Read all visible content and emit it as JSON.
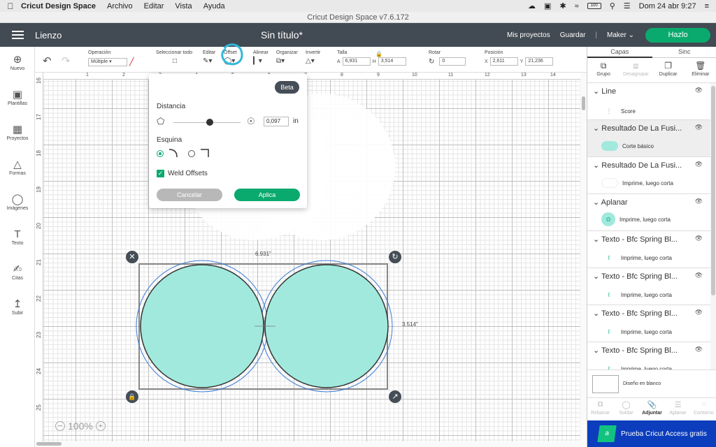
{
  "macos": {
    "app_name": "Cricut Design Space",
    "menus": [
      "Archivo",
      "Editar",
      "Vista",
      "Ayuda"
    ],
    "datetime": "Dom 24 abr  9:27",
    "battery": "100"
  },
  "window_title": "Cricut Design Space  v7.6.172",
  "header": {
    "section": "Lienzo",
    "doc_title": "Sin título*",
    "my_projects": "Mis proyectos",
    "save": "Guardar",
    "separator": "|",
    "machine": "Maker",
    "make_button": "Hazlo"
  },
  "leftnav": [
    "Nuevo",
    "Plantillas",
    "Proyectos",
    "Formas",
    "Imágenes",
    "Texto",
    "Citas",
    "Subir"
  ],
  "toolbar": {
    "operation_label": "Operación",
    "operation_value": "Múltiple",
    "select_all": "Seleccionar todo",
    "edit": "Editar",
    "offset": "Offset",
    "align": "Alinear",
    "organize": "Organizar",
    "flip": "Invertir",
    "size": "Talla",
    "width_label": "A",
    "width_value": "6,931",
    "height_label": "H",
    "height_value": "3,514",
    "rotate": "Rotar",
    "rotate_value": "0",
    "position": "Posición",
    "x_label": "X",
    "x_value": "2,611",
    "y_label": "Y",
    "y_value": "21,236"
  },
  "rulers": {
    "top": [
      "1",
      "2",
      "3",
      "4",
      "5",
      "6",
      "7",
      "8",
      "9",
      "10",
      "11",
      "12",
      "13",
      "14"
    ],
    "left": [
      "16",
      "17",
      "18",
      "19",
      "20",
      "21",
      "22",
      "23",
      "24",
      "25"
    ]
  },
  "canvas": {
    "width_dim": "6.931\"",
    "height_dim": "3.514\"",
    "zoom": "100%",
    "fill_color": "#a1e9dd",
    "offset_color": "#3b7bd6"
  },
  "offset_popup": {
    "badge": "Beta",
    "distance_label": "Distancia",
    "distance_value": "0,097",
    "unit": "in",
    "slider_value": 0.55,
    "corner_label": "Esquina",
    "weld_label": "Weld Offsets",
    "cancel": "Cancelar",
    "apply": "Aplica"
  },
  "panel": {
    "tabs": [
      "Capas",
      "Sinc"
    ],
    "actions": [
      "Grupo",
      "Desagrupar",
      "Duplicar",
      "Eliminar"
    ],
    "layers": [
      {
        "name": "Line",
        "child": "Score"
      },
      {
        "name": "Resultado De La Fusi...",
        "child": "Corte básico"
      },
      {
        "name": "Resultado De La Fusi...",
        "child": "Imprime, luego corta"
      },
      {
        "name": "Aplanar",
        "child": "Imprime, luego corta"
      },
      {
        "name": "Texto - Bfc Spring Bl...",
        "child": "Imprime, luego corta"
      },
      {
        "name": "Texto - Bfc Spring Bl...",
        "child": "Imprime, luego corta"
      },
      {
        "name": "Texto - Bfc Spring Bl...",
        "child": "Imprime, luego corta"
      },
      {
        "name": "Texto - Bfc Spring Bl...",
        "child": "Imprime, luego corta"
      }
    ],
    "blank_canvas": "Diseño en blanco",
    "bottom_actions": [
      "Rebanar",
      "Soldar",
      "Adjuntar",
      "Aplanar",
      "Contorno"
    ],
    "promo": "Prueba Cricut Access gratis"
  },
  "colors": {
    "header_bg": "#424a53",
    "accent_green": "#0aaa6e",
    "promo_blue": "#0b3dbd"
  }
}
